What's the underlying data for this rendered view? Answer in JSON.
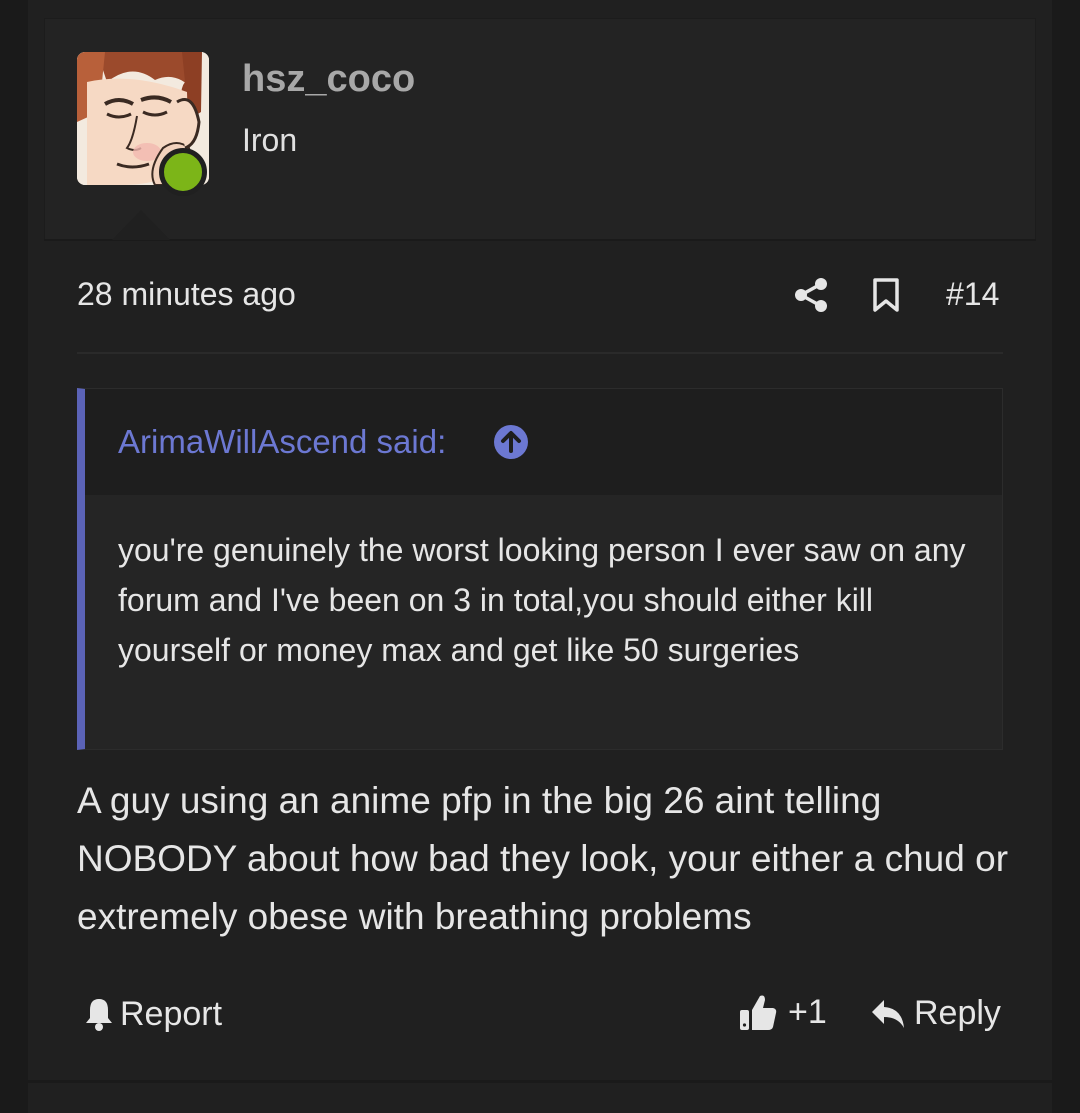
{
  "author": {
    "username": "hsz_coco",
    "title": "Iron",
    "online": true
  },
  "post": {
    "time": "28 minutes ago",
    "number": "#14",
    "quote": {
      "author": "ArimaWillAscend said:",
      "text": "you're genuinely the worst looking person I ever saw on any forum and I've been on 3 in total,you should either kill yourself or money max and get like 50 surgeries"
    },
    "body": "A guy using an anime pfp in the big 26 aint telling NOBODY about how bad they look, your either a chud or extremely obese with breathing problems"
  },
  "actions": {
    "report_label": "Report",
    "like_count": "+1",
    "reply_label": "Reply"
  },
  "colors": {
    "accent": "#5b63b7",
    "quote_author": "#6c78d2",
    "online": "#7cb518"
  },
  "icons": [
    "share-icon",
    "bookmark-icon",
    "arrow-up-circle-icon",
    "bell-icon",
    "thumbs-up-icon",
    "reply-arrow-icon"
  ]
}
